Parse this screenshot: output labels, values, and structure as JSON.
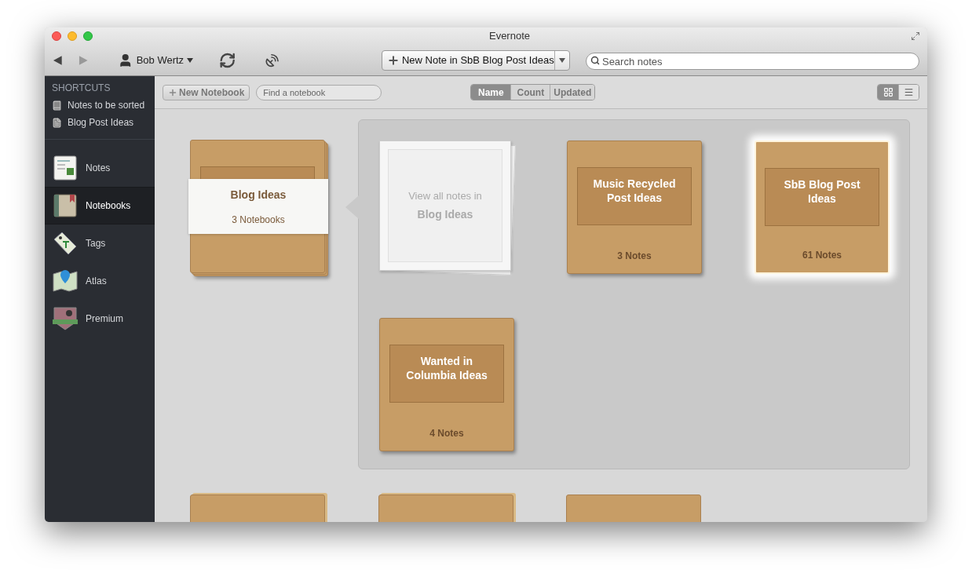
{
  "window": {
    "title": "Evernote"
  },
  "toolbar": {
    "user": "Bob Wertz",
    "new_note_button": "New Note in SbB Blog Post Ideas",
    "search": {
      "placeholder": "Search notes"
    }
  },
  "sidebar": {
    "shortcuts_heading": "SHORTCUTS",
    "shortcuts": [
      {
        "label": "Notes to be sorted",
        "kind": "notebook"
      },
      {
        "label": "Blog Post Ideas",
        "kind": "note"
      }
    ],
    "items": [
      {
        "label": "Notes",
        "kind": "notes",
        "selected": false
      },
      {
        "label": "Notebooks",
        "kind": "notebooks",
        "selected": true
      },
      {
        "label": "Tags",
        "kind": "tags",
        "selected": false
      },
      {
        "label": "Atlas",
        "kind": "atlas",
        "selected": false
      },
      {
        "label": "Premium",
        "kind": "premium",
        "selected": false
      }
    ]
  },
  "content_toolbar": {
    "new_notebook_button": "New Notebook",
    "find": {
      "placeholder": "Find a notebook"
    },
    "sort_tabs": [
      {
        "label": "Name",
        "selected": true
      },
      {
        "label": "Count",
        "selected": false
      },
      {
        "label": "Updated",
        "selected": false
      }
    ],
    "view_toggle": [
      {
        "kind": "grid",
        "selected": true
      },
      {
        "kind": "list",
        "selected": false
      }
    ]
  },
  "stack": {
    "title": "Blog Ideas",
    "count": "3 Notebooks",
    "expanded": true
  },
  "stack_panel": {
    "view_all": {
      "line1": "View all notes in",
      "line2": "Blog Ideas"
    },
    "notebooks": [
      {
        "title": "Music Recycled Post Ideas",
        "count": "3 Notes",
        "selected": false
      },
      {
        "title": "SbB Blog Post Ideas",
        "count": "61 Notes",
        "selected": true
      },
      {
        "title": "Wanted in Columbia Ideas",
        "count": "4 Notes",
        "selected": false
      }
    ]
  },
  "more_notebooks": [
    {
      "kind": "stack"
    },
    {
      "kind": "stack"
    },
    {
      "kind": "notebook"
    }
  ]
}
